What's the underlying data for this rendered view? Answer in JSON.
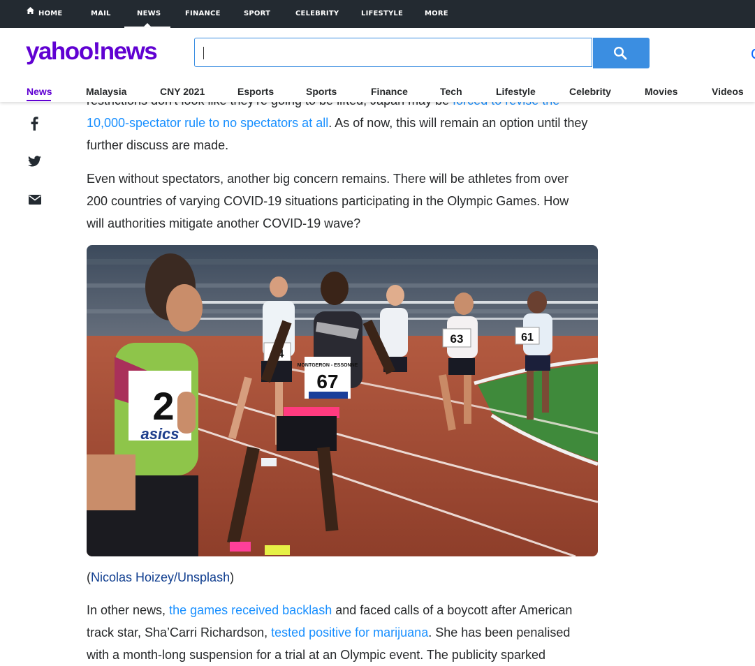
{
  "topnav": {
    "items": [
      {
        "label": "HOME"
      },
      {
        "label": "MAIL"
      },
      {
        "label": "NEWS"
      },
      {
        "label": "FINANCE"
      },
      {
        "label": "SPORT"
      },
      {
        "label": "CELEBRITY"
      },
      {
        "label": "LIFESTYLE"
      },
      {
        "label": "MORE"
      }
    ],
    "active": "NEWS"
  },
  "header": {
    "logo_text": "yahoo!news",
    "search": {
      "value": "",
      "placeholder": ""
    },
    "brand_color": "#6001d2",
    "search_button_color": "#3b8ee1"
  },
  "subnav": {
    "items": [
      {
        "label": "News"
      },
      {
        "label": "Malaysia"
      },
      {
        "label": "CNY 2021"
      },
      {
        "label": "Esports"
      },
      {
        "label": "Sports"
      },
      {
        "label": "Finance"
      },
      {
        "label": "Tech"
      },
      {
        "label": "Lifestyle"
      },
      {
        "label": "Celebrity"
      },
      {
        "label": "Movies"
      },
      {
        "label": "Videos"
      }
    ],
    "active": "News"
  },
  "share": {
    "icons": [
      "facebook-icon",
      "twitter-icon",
      "email-icon"
    ]
  },
  "article": {
    "p1": {
      "text_before": "restrictions don't look like they're going to be lifted, Japan may be ",
      "link": "forced to revise the 10,000-spectator rule to no spectators at all",
      "text_after": ". As of now, this will remain an option until they further discuss are made."
    },
    "p2": "Even without spectators, another big concern remains. There will be athletes from over 200 countries of varying COVID-19 situations participating in the Olympic Games. How will authorities mitigate another COVID-19 wave?",
    "photo": {
      "bibs": [
        "2",
        "64",
        "67",
        "63",
        "61"
      ],
      "bib_headers": [
        "MONTGERON - ESSONNE"
      ],
      "sponsor": "asics"
    },
    "credit": {
      "open": "(",
      "link": "Nicolas Hoizey/Unsplash",
      "close": ")"
    },
    "p3": {
      "t1": "In other news, ",
      "link1": "the games received backlash",
      "t2": " and faced calls of a boycott after American track star, Sha’Carri Richardson, ",
      "link2": "tested positive for marijuana",
      "t3": ". She has been penalised with a month-long suspension for a trial at an Olympic event. The publicity sparked"
    },
    "link_color": "#188fff"
  }
}
